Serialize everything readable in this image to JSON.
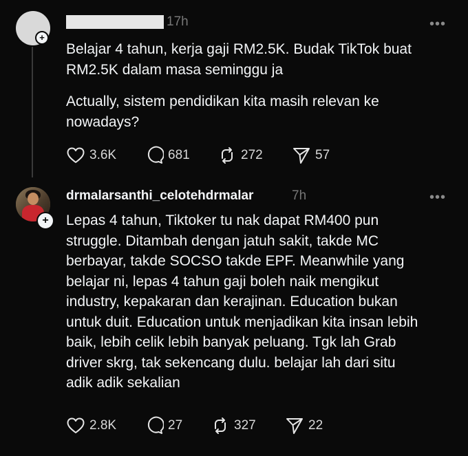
{
  "posts": [
    {
      "username": "",
      "time": "17h",
      "text": "Belajar 4 tahun, kerja gaji RM2.5K. Budak TikTok buat\nRM2.5K dalam masa seminggu ja",
      "text2": "Actually, sistem pendidikan kita masih relevan ke\nnowadays?",
      "likes": "3.6K",
      "replies": "681",
      "reposts": "272",
      "shares": "57"
    },
    {
      "username": "drmalarsanthi_celotehdrmalar",
      "time": "7h",
      "text": "Lepas 4 tahun, Tiktoker tu nak dapat RM400 pun\nstruggle. Ditambah dengan jatuh sakit, takde MC\nberbayar, takde SOCSO takde EPF. Meanwhile yang\nbelajar ni, lepas 4 tahun gaji boleh naik mengikut\nindustry, kepakaran dan kerajinan. Education bukan\nuntuk duit. Education untuk menjadikan kita insan lebih\nbaik, lebih celik lebih banyak peluang. Tgk lah Grab\ndriver skrg, tak sekencang dulu. belajar lah dari situ\nadik adik sekalian",
      "likes": "2.8K",
      "replies": "27",
      "reposts": "327",
      "shares": "22"
    }
  ],
  "icons": {
    "more": "more-icon",
    "like": "heart-icon",
    "reply": "comment-icon",
    "repost": "repost-icon",
    "share": "send-icon",
    "follow": "plus-icon"
  },
  "follow_symbol": "+",
  "more_symbol": "•••"
}
